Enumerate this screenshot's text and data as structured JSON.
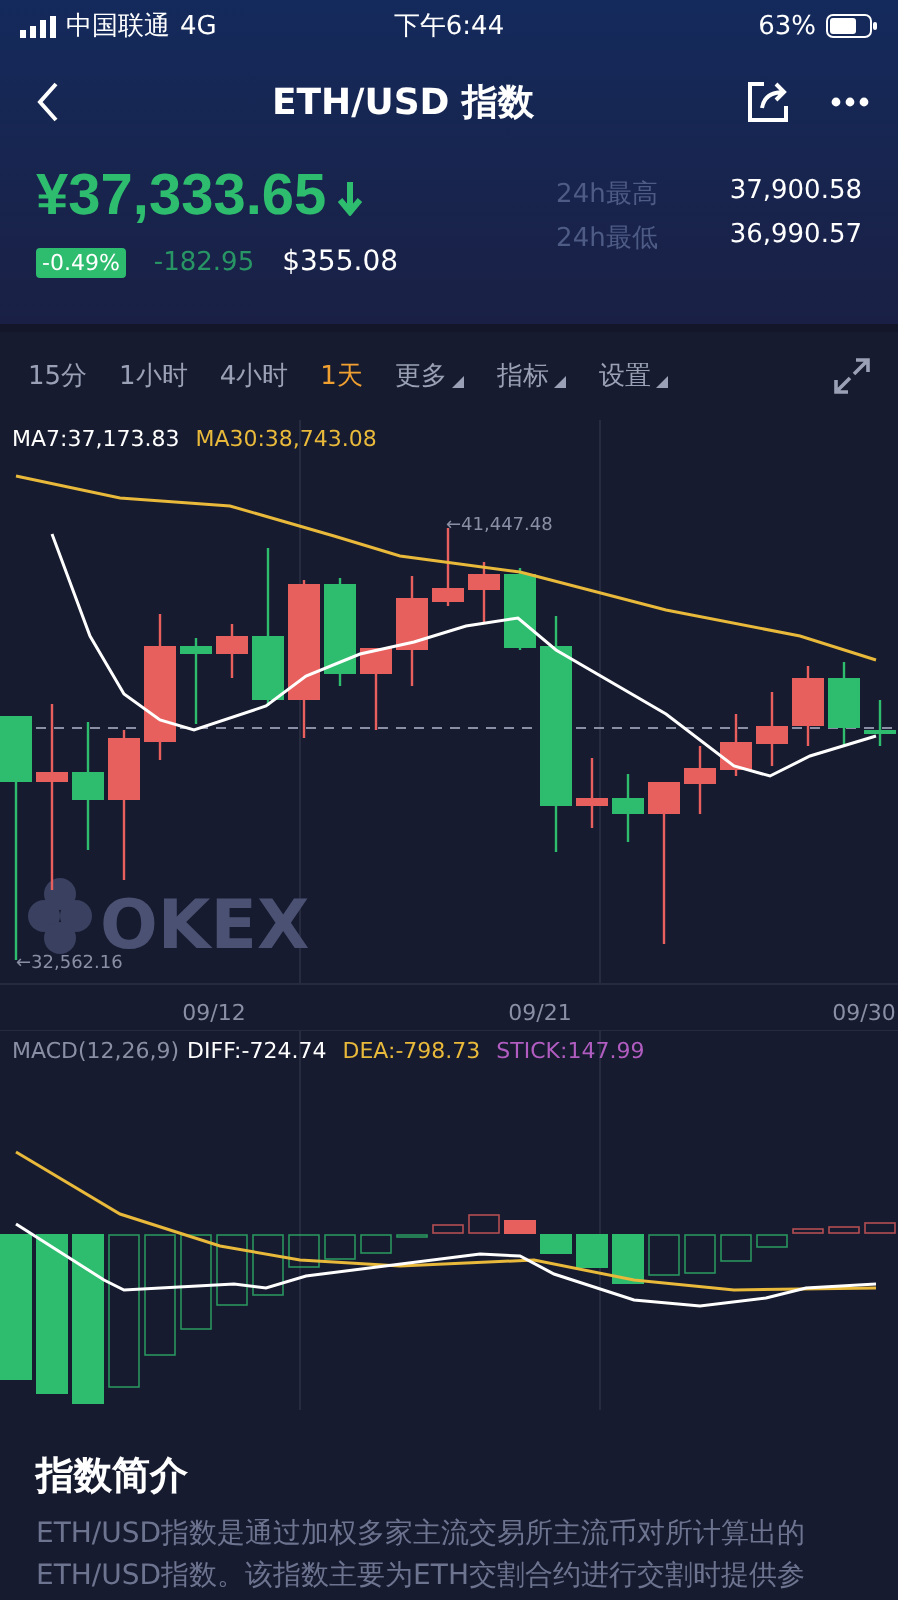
{
  "status_bar": {
    "carrier": "中国联通",
    "network": "4G",
    "time": "下午6:44",
    "battery": "63%"
  },
  "nav": {
    "title": "ETH/USD 指数"
  },
  "price": {
    "value": "¥37,333.65",
    "falling": true,
    "change_pct": "-0.49%",
    "change": "-182.95",
    "usd": "$355.08",
    "stats": [
      {
        "label": "24h最高",
        "value": "37,900.58"
      },
      {
        "label": "24h最低",
        "value": "36,990.57"
      }
    ]
  },
  "intervals": [
    {
      "label": "15分",
      "kind": "option",
      "selected": false
    },
    {
      "label": "1小时",
      "kind": "option",
      "selected": false
    },
    {
      "label": "4小时",
      "kind": "option",
      "selected": false
    },
    {
      "label": "1天",
      "kind": "option",
      "selected": true
    },
    {
      "label": "更多",
      "kind": "dropdown",
      "selected": false
    },
    {
      "label": "指标",
      "kind": "dropdown",
      "selected": false
    },
    {
      "label": "设置",
      "kind": "dropdown",
      "selected": false
    }
  ],
  "chart": {
    "ma": [
      {
        "label": "MA7:37,173.83",
        "color": "#ffffff"
      },
      {
        "label": "MA30:38,743.08",
        "color": "#e8b93a"
      }
    ],
    "high_marker": "←41,447.48",
    "low_marker": "←32,562.16",
    "watermark": "OKEX",
    "dates": [
      "09/12",
      "09/21",
      "09/30"
    ]
  },
  "macd": {
    "labels": [
      {
        "label": "MACD(12,26,9)",
        "color": "#8a8fa5"
      },
      {
        "label": "DIFF:-724.74",
        "color": "#ffffff"
      },
      {
        "label": "DEA:-798.73",
        "color": "#e8b93a"
      },
      {
        "label": "STICK:147.99",
        "color": "#b05cc0"
      }
    ]
  },
  "intro": {
    "title": "指数简介",
    "text": "ETH/USD指数是通过加权多家主流交易所主流币对所计算出的ETH/USD指数。该指数主要为ETH交割合约进行交割时提供参"
  }
}
